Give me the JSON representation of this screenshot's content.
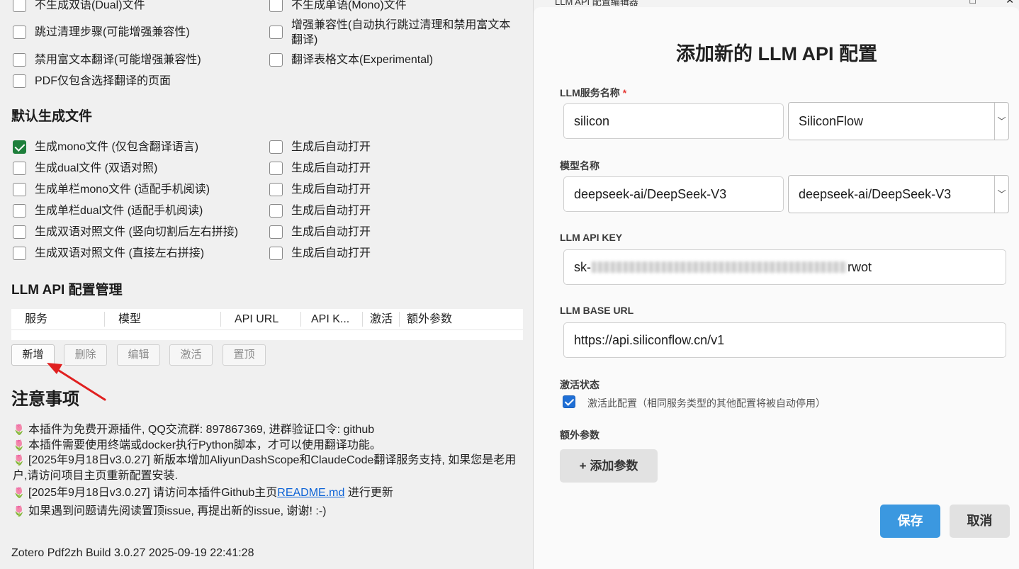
{
  "options": {
    "col1": [
      {
        "label": "不生成双语(Dual)文件",
        "checked": false
      },
      {
        "label": "跳过清理步骤(可能增强兼容性)",
        "checked": false
      },
      {
        "label": "禁用富文本翻译(可能增强兼容性)",
        "checked": false
      },
      {
        "label": "PDF仅包含选择翻译的页面",
        "checked": false
      }
    ],
    "col2": [
      {
        "label": "不生成单语(Mono)文件",
        "checked": false
      },
      {
        "label": "增强兼容性(自动执行跳过清理和禁用富文本翻译)",
        "checked": false
      },
      {
        "label": "翻译表格文本(Experimental)",
        "checked": false
      }
    ]
  },
  "default_files": {
    "title": "默认生成文件",
    "items": [
      {
        "label": "生成mono文件 (仅包含翻译语言)",
        "checked": true,
        "auto_open": "生成后自动打开"
      },
      {
        "label": "生成dual文件 (双语对照)",
        "checked": false,
        "auto_open": "生成后自动打开"
      },
      {
        "label": "生成单栏mono文件 (适配手机阅读)",
        "checked": false,
        "auto_open": "生成后自动打开"
      },
      {
        "label": "生成单栏dual文件 (适配手机阅读)",
        "checked": false,
        "auto_open": "生成后自动打开"
      },
      {
        "label": "生成双语对照文件 (竖向切割后左右拼接)",
        "checked": false,
        "auto_open": "生成后自动打开"
      },
      {
        "label": "生成双语对照文件 (直接左右拼接)",
        "checked": false,
        "auto_open": "生成后自动打开"
      }
    ]
  },
  "llm_manage": {
    "title": "LLM API 配置管理",
    "columns": [
      "服务",
      "模型",
      "API URL",
      "API K...",
      "激活",
      "额外参数"
    ],
    "buttons": {
      "add": "新增",
      "delete": "删除",
      "edit": "编辑",
      "activate": "激活",
      "top": "置顶"
    }
  },
  "notes": {
    "title": "注意事项",
    "flower": "🌷",
    "lines": [
      "本插件为免费开源插件, QQ交流群: 897867369, 进群验证口令: github",
      "本插件需要使用终端或docker执行Python脚本，才可以使用翻译功能。",
      "[2025年9月18日v3.0.27] 新版本增加AliyunDashScope和ClaudeCode翻译服务支持, 如果您是老用户,请访问项目主页重新配置安装.",
      "[2025年9月18日v3.0.27] 请访问本插件Github主页",
      "如果遇到问题请先阅读置顶issue, 再提出新的issue, 谢谢! :-)"
    ],
    "readme_link": "README.md",
    "readme_suffix": " 进行更新"
  },
  "footer": "Zotero Pdf2zh Build 3.0.27 2025-09-19 22:41:28",
  "dialog": {
    "window_title": "LLM API 配置编辑器",
    "heading": "添加新的 LLM API 配置",
    "service_label": "LLM服务名称",
    "required_mark": "*",
    "service_value": "silicon",
    "service_select": "SiliconFlow",
    "model_label": "模型名称",
    "model_value": "deepseek-ai/DeepSeek-V3",
    "model_select": "deepseek-ai/DeepSeek-V3",
    "apikey_label": "LLM API KEY",
    "apikey_prefix": "sk-",
    "apikey_suffix": "rwot",
    "baseurl_label": "LLM BASE URL",
    "baseurl_value": "https://api.siliconflow.cn/v1",
    "active_label": "激活状态",
    "active_text": "激活此配置（相同服务类型的其他配置将被自动停用）",
    "active_checked": true,
    "extra_label": "额外参数",
    "add_param": "+ 添加参数",
    "save": "保存",
    "cancel": "取消"
  },
  "colors": {
    "accent_blue": "#3b98e0",
    "checkbox_green": "#1e7f3b",
    "arrow_red": "#e02020",
    "link": "#0b62d6"
  }
}
